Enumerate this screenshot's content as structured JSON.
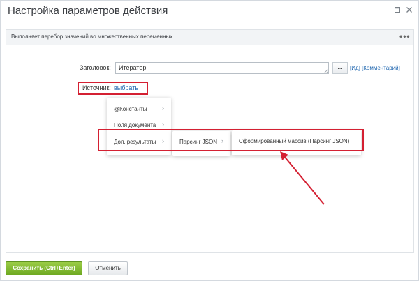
{
  "dialog": {
    "title": "Настройка параметров действия"
  },
  "panel": {
    "description": "Выполняет перебор значений во множественных переменных",
    "menu_glyph": "•••"
  },
  "form": {
    "title_label": "Заголовок:",
    "title_value": "Итератор",
    "dots_button": "...",
    "id_link": "[Ид]",
    "comment_link": "[Комментарий]",
    "source_label": "Источник:",
    "source_link": "выбрать"
  },
  "menus": {
    "level1": [
      {
        "label": "@Константы",
        "chevron": "›"
      },
      {
        "label": "Поля документа",
        "chevron": "›"
      },
      {
        "label": "Доп. результаты",
        "chevron": "›"
      }
    ],
    "level2": [
      {
        "label": "Парсинг JSON",
        "chevron": "›"
      }
    ],
    "level3": [
      {
        "label": "Сформированный массив (Парсинг JSON)"
      }
    ]
  },
  "footer": {
    "save_label": "Сохранить (Ctrl+Enter)",
    "cancel_label": "Отменить"
  },
  "colors": {
    "highlight": "#d42032",
    "save_button": "#7ab42e",
    "link": "#2067b0"
  }
}
